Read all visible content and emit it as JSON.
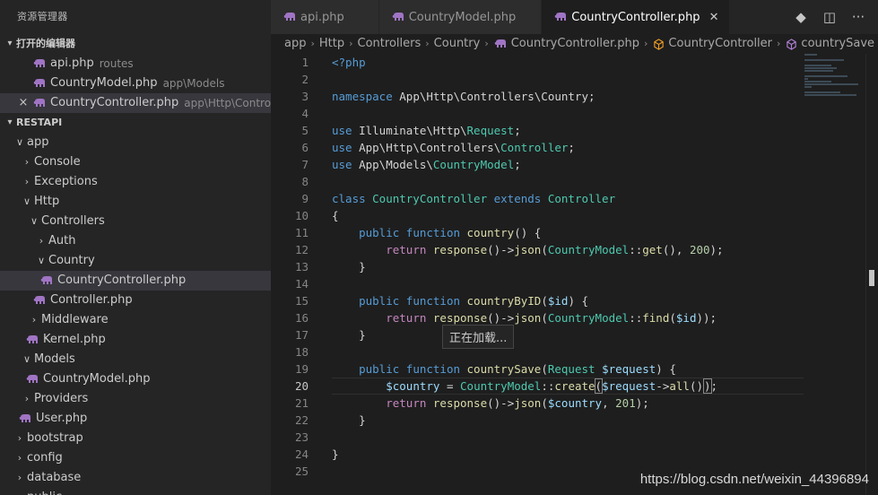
{
  "sidebar": {
    "title": "资源管理器",
    "open_editors": {
      "header": "打开的编辑器",
      "items": [
        {
          "name": "api.php",
          "desc": "routes"
        },
        {
          "name": "CountryModel.php",
          "desc": "app\\Models"
        },
        {
          "name": "CountryController.php",
          "desc": "app\\Http\\Controller..."
        }
      ]
    },
    "project": {
      "header": "RESTAPI",
      "items": [
        {
          "label": "app"
        },
        {
          "label": "Console"
        },
        {
          "label": "Exceptions"
        },
        {
          "label": "Http"
        },
        {
          "label": "Controllers"
        },
        {
          "label": "Auth"
        },
        {
          "label": "Country"
        },
        {
          "label": "CountryController.php"
        },
        {
          "label": "Controller.php"
        },
        {
          "label": "Middleware"
        },
        {
          "label": "Kernel.php"
        },
        {
          "label": "Models"
        },
        {
          "label": "CountryModel.php"
        },
        {
          "label": "Providers"
        },
        {
          "label": "User.php"
        },
        {
          "label": "bootstrap"
        },
        {
          "label": "config"
        },
        {
          "label": "database"
        },
        {
          "label": "public"
        }
      ]
    }
  },
  "tabs": [
    {
      "label": "api.php"
    },
    {
      "label": "CountryModel.php"
    },
    {
      "label": "CountryController.php"
    }
  ],
  "breadcrumb": [
    "app",
    "Http",
    "Controllers",
    "Country",
    "CountryController.php",
    "CountryController",
    "countrySave"
  ],
  "editor": {
    "line_numbers": [
      "1",
      "2",
      "3",
      "4",
      "5",
      "6",
      "7",
      "8",
      "9",
      "10",
      "11",
      "12",
      "13",
      "14",
      "15",
      "16",
      "17",
      "18",
      "19",
      "20",
      "21",
      "22",
      "23",
      "24",
      "25"
    ],
    "current_line": "20"
  },
  "tooltip": "正在加载...",
  "watermark": "https://blog.csdn.net/weixin_44396894",
  "colors": {
    "sidebar_bg": "#252526",
    "editor_bg": "#1e1e1e",
    "php_icon": "#a074c4",
    "keyword": "#569cd6",
    "type": "#4ec9b0",
    "function": "#dcdcaa",
    "variable": "#9cdcfe",
    "number": "#b5cea8"
  },
  "icons": {
    "php_file": "elephant-icon",
    "close": "close-icon",
    "chevron_down": "chevron-down-icon",
    "chevron_right": "chevron-right-icon",
    "git": "git-compare-icon",
    "split": "split-editor-icon",
    "more": "more-actions-icon",
    "method": "method-cube-icon"
  }
}
